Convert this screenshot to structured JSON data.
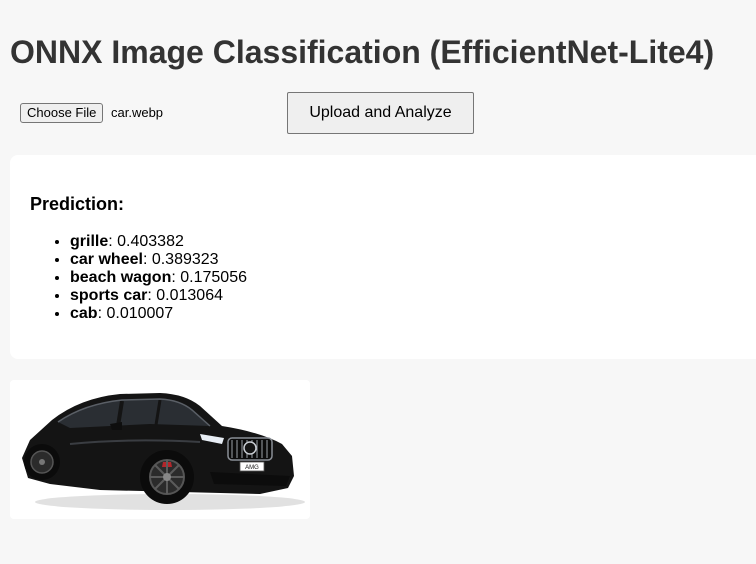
{
  "page": {
    "title": "ONNX Image Classification (EfficientNet-Lite4)"
  },
  "upload": {
    "choose_label": "Choose File",
    "file_name": "car.webp",
    "analyze_label": "Upload and Analyze"
  },
  "result": {
    "heading": "Prediction:",
    "predictions": [
      {
        "label": "grille",
        "score": "0.403382"
      },
      {
        "label": "car wheel",
        "score": "0.389323"
      },
      {
        "label": "beach wagon",
        "score": "0.175056"
      },
      {
        "label": "sports car",
        "score": "0.013064"
      },
      {
        "label": "cab",
        "score": "0.010007"
      }
    ]
  },
  "preview": {
    "subject": "black SUV coupe",
    "plate_text": "AMG",
    "colors": {
      "body": "#141414",
      "glass": "#2a2e33",
      "chrome": "#b8bcc2",
      "background": "#ffffff"
    }
  }
}
